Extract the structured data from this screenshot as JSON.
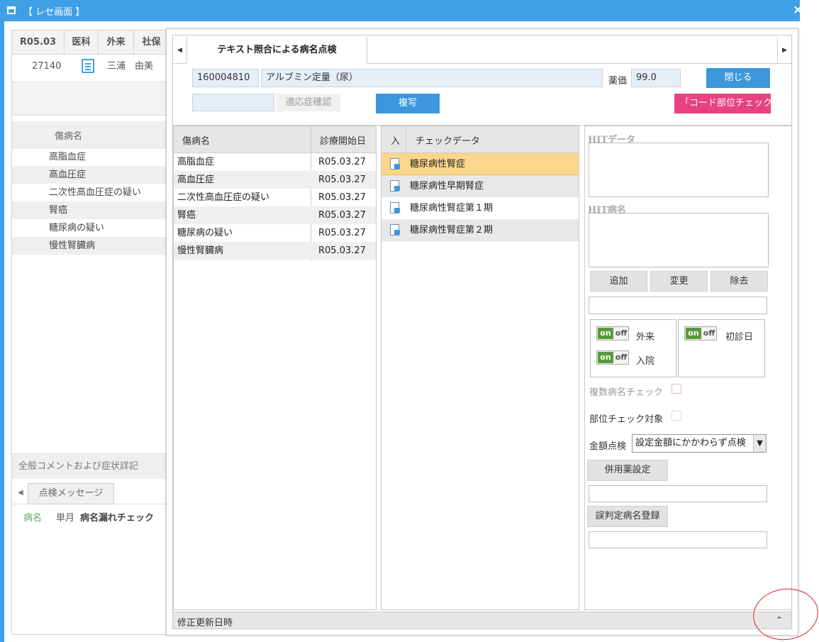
{
  "window": {
    "title": "【 レセ画面 】",
    "close_label": "×"
  },
  "background": {
    "header": {
      "date": "R05.03",
      "dept": "医科",
      "visit": "外来",
      "insurance": "社保"
    },
    "patient": {
      "id": "27140",
      "name": "三浦　由美"
    },
    "dx_header": "傷病名",
    "diagnoses": [
      "高脂血症",
      "高血圧症",
      "二次性高血圧症の疑い",
      "腎癌",
      "糖尿病の疑い",
      "慢性腎臓病"
    ],
    "comment_label": "全般コメントおよび症状詳記",
    "message_tab": "点検メッセージ",
    "message": {
      "category": "病名",
      "period": "単月",
      "text": "病名漏れチェック"
    }
  },
  "dialog": {
    "tab_label": "テキスト照合による病名点検",
    "code": "160004810",
    "item_name": "アルブミン定量（尿）",
    "price_label": "薬価",
    "price_value": "99.0",
    "close_button": "閉じる",
    "indication_input": "",
    "indication_button": "適応症確認",
    "copy_button": "複写",
    "code_check_button": "「コード部位チェック」",
    "dx_grid": {
      "col_name": "傷病名",
      "col_date": "診療開始日",
      "rows": [
        {
          "name": "高脂血症",
          "date": "R05.03.27"
        },
        {
          "name": "高血圧症",
          "date": "R05.03.27"
        },
        {
          "name": "二次性高血圧症の疑い",
          "date": "R05.03.27"
        },
        {
          "name": "腎癌",
          "date": "R05.03.27"
        },
        {
          "name": "糖尿病の疑い",
          "date": "R05.03.27"
        },
        {
          "name": "慢性腎臓病",
          "date": "R05.03.27"
        }
      ]
    },
    "check_grid": {
      "col_in": "入",
      "col_data": "チェックデータ",
      "rows": [
        "糖尿病性腎症",
        "糖尿病性早期腎症",
        "糖尿病性腎症第１期",
        "糖尿病性腎症第２期"
      ]
    },
    "hit_data_label": "HITデータ",
    "hit_dx_label": "HIT病名",
    "add_button": "追加",
    "change_button": "変更",
    "remove_button": "除去",
    "toggle_on": "on",
    "toggle_off": "off",
    "outpatient_label": "外来",
    "inpatient_label": "入院",
    "first_visit_label": "初診日",
    "multi_dx_check_label": "複数病名チェック",
    "site_check_label": "部位チェック対象",
    "amount_check_label": "金額点検",
    "amount_check_value": "設定金額にかかわらず点検",
    "concomitant_button": "併用薬設定",
    "misjudge_button": "誤判定病名登録",
    "footer_label": "修正更新日時",
    "footer_arrow": "⌃"
  }
}
